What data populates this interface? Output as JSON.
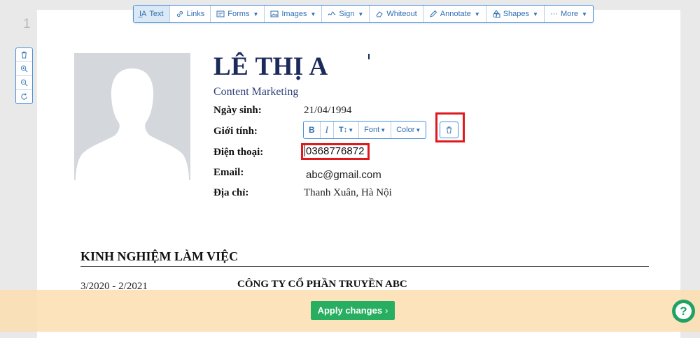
{
  "page_number": "1",
  "toolbar": {
    "text": "Text",
    "links": "Links",
    "forms": "Forms",
    "images": "Images",
    "sign": "Sign",
    "whiteout": "Whiteout",
    "annotate": "Annotate",
    "shapes": "Shapes",
    "more": "More"
  },
  "cv": {
    "name": "LÊ THỊ A",
    "role": "Content Marketing",
    "fields": [
      {
        "label": "Ngày sinh:",
        "value": "21/04/1994"
      },
      {
        "label": "Giới tính:",
        "value": ""
      },
      {
        "label": "Điện thoại:",
        "value": "0368776872"
      },
      {
        "label": "Email:",
        "value": "abc@gmail.com"
      },
      {
        "label": "Địa chỉ:",
        "value": "Thanh Xuân, Hà Nội"
      }
    ],
    "section_title": "KINH NGHIỆM LÀM VIỆC",
    "experience": {
      "period": "3/2020 - 2/2021",
      "company": "CÔNG TY CỔ PHẦN TRUYỀN ABC"
    }
  },
  "format_toolbar": {
    "bold": "B",
    "italic": "I",
    "size": "T↕",
    "font": "Font",
    "color": "Color"
  },
  "apply_button": "Apply changes",
  "help_label": "?"
}
